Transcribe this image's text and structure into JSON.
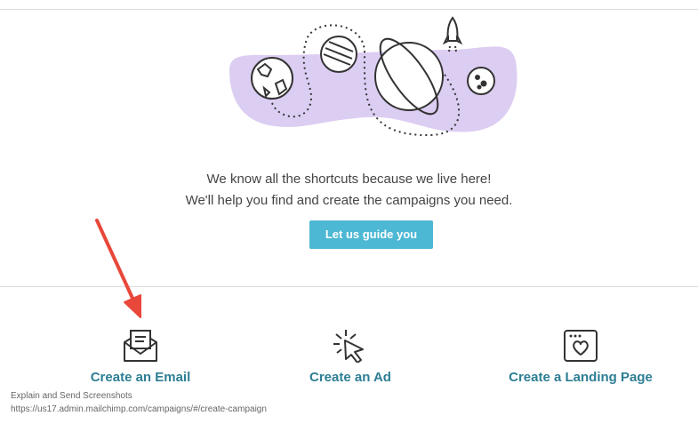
{
  "hero": {
    "line1": "We know all the shortcuts because we live here!",
    "line2": "We'll help you find and create the campaigns you need.",
    "guide_button": "Let us guide you"
  },
  "options": [
    {
      "label": "Create an Email",
      "icon": "envelope-icon"
    },
    {
      "label": "Create an Ad",
      "icon": "cursor-click-icon"
    },
    {
      "label": "Create a Landing Page",
      "icon": "browser-heart-icon"
    }
  ],
  "tooltip": {
    "title": "Explain and Send Screenshots",
    "url": "https://us17.admin.mailchimp.com/campaigns/#/create-campaign"
  },
  "colors": {
    "accent_button": "#4cb8d4",
    "link": "#2d7e93",
    "blob": "#dccdf2",
    "annotation_arrow": "#e8473a"
  }
}
